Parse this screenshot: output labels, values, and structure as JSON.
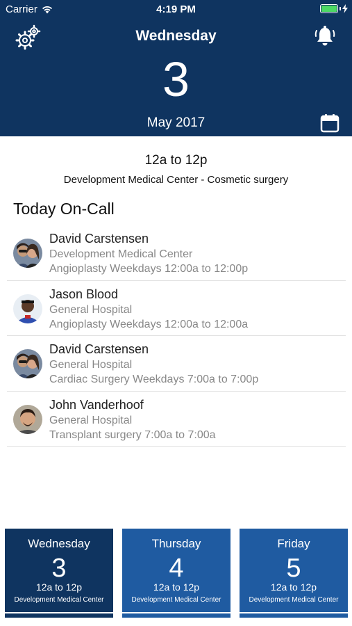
{
  "status_bar": {
    "carrier": "Carrier",
    "time": "4:19 PM"
  },
  "header": {
    "day_name": "Wednesday",
    "day_number": "3",
    "month_year": "May 2017",
    "icons": {
      "settings": "gear-icon",
      "notifications": "bell-icon",
      "calendar": "calendar-icon"
    },
    "background_color": "#0f3460"
  },
  "shift": {
    "time": "12a to 12p",
    "place": "Development Medical Center - Cosmetic surgery"
  },
  "section_title": "Today On-Call",
  "oncall": [
    {
      "name": "David Carstensen",
      "location": "Development Medical Center",
      "shift": "Angioplasty Weekdays 12:00a to 12:00p"
    },
    {
      "name": "Jason Blood",
      "location": "General Hospital",
      "shift": "Angioplasty Weekdays 12:00a to 12:00a"
    },
    {
      "name": "David Carstensen",
      "location": "General Hospital",
      "shift": "Cardiac Surgery Weekdays 7:00a to 7:00p"
    },
    {
      "name": "John Vanderhoof",
      "location": "General Hospital",
      "shift": "Transplant surgery  7:00a to 7:00a"
    }
  ],
  "day_cards": [
    {
      "day": "Wednesday",
      "number": "3",
      "time": "12a to 12p",
      "place": "Development Medical Center",
      "selected": true
    },
    {
      "day": "Thursday",
      "number": "4",
      "time": "12a to 12p",
      "place": "Development Medical Center",
      "selected": false
    },
    {
      "day": "Friday",
      "number": "5",
      "time": "12a to 12p",
      "place": "Development Medical Center",
      "selected": false
    }
  ],
  "colors": {
    "header": "#0f3460",
    "card": "#1f5ba1",
    "card_selected": "#0f3460",
    "battery": "#4cd964"
  }
}
